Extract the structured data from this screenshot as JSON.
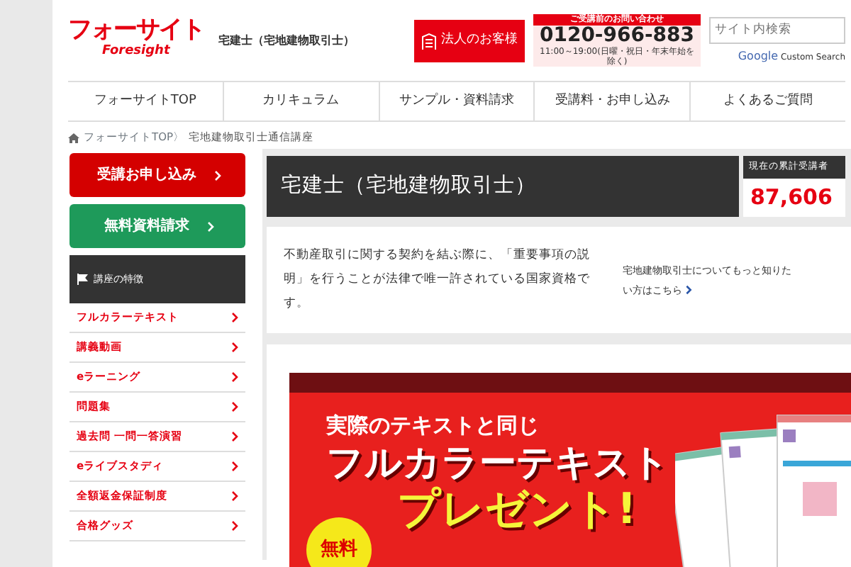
{
  "header": {
    "logo": "フォーサイト",
    "logo_sub": "Foresight",
    "site_title": "宅建士（宅地建物取引士）",
    "corporate_button": "法人のお客様",
    "contact": {
      "caption": "ご受講前のお問い合わせ",
      "phone": "0120-966-883",
      "hours": "11:00～19:00(日曜・祝日・年末年始を除く)"
    },
    "search": {
      "placeholder": "サイト内検索",
      "provider": "Google",
      "provider_note": "Custom Search"
    }
  },
  "nav": [
    {
      "label": "フォーサイトTOP"
    },
    {
      "label": "カリキュラム"
    },
    {
      "label": "サンプル・資料請求"
    },
    {
      "label": "受講料・お申し込み"
    },
    {
      "label": "よくあるご質問"
    }
  ],
  "breadcrumb": [
    "フォーサイトTOP〉",
    "宅地建物取引士通信講座"
  ],
  "sidebar": {
    "buttons": [
      {
        "label": "受講お申し込み",
        "kind": "apply"
      },
      {
        "label": "無料資料請求",
        "kind": "request"
      }
    ],
    "section_title": "講座の特徴",
    "items": [
      {
        "label": "フルカラーテキスト"
      },
      {
        "label": "講義動画"
      },
      {
        "label": "eラーニング"
      },
      {
        "label": "問題集"
      },
      {
        "label": "過去問 一問一答演習"
      },
      {
        "label": "eライブスタディ"
      },
      {
        "label": "全額返金保証制度"
      },
      {
        "label": "合格グッズ"
      }
    ]
  },
  "main": {
    "title": "宅建士（宅地建物取引士）",
    "counter": {
      "caption": "現在の累計受講者",
      "value": "87,606"
    },
    "description": "不動産取引に関する契約を結ぶ際に、「重要事項の説明」を行うことが法律で唯一許されている国家資格です。",
    "more_link": "宅地建物取引士についてもっと知りたい方はこちら",
    "banner": {
      "lead": "実際のテキストと同じ",
      "headline": "フルカラーテキスト",
      "emphasis": "プレゼント!",
      "badge": "無料"
    }
  }
}
